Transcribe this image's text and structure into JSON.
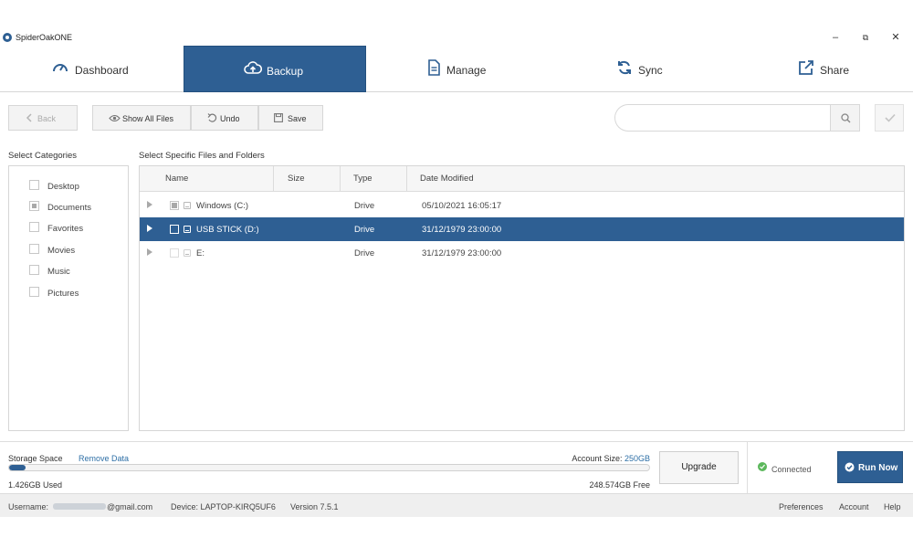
{
  "app": {
    "title": "SpiderOakONE",
    "logo_icon": "spideroak-logo-icon"
  },
  "window": {
    "minimize": "–",
    "restore": "⧉",
    "close": "✕"
  },
  "tabs": [
    {
      "label": "Dashboard",
      "icon": "gauge-icon",
      "active": false
    },
    {
      "label": "Backup",
      "icon": "cloud-upload-icon",
      "active": true
    },
    {
      "label": "Manage",
      "icon": "document-icon",
      "active": false
    },
    {
      "label": "Sync",
      "icon": "sync-icon",
      "active": false
    },
    {
      "label": "Share",
      "icon": "share-icon",
      "active": false
    }
  ],
  "toolbar": {
    "back_label": "Back",
    "show_all_label": "Show All Files",
    "undo_label": "Undo",
    "save_label": "Save",
    "search_placeholder": ""
  },
  "categories": {
    "header": "Select Categories",
    "items": [
      {
        "label": "Desktop",
        "state": "unchecked"
      },
      {
        "label": "Documents",
        "state": "partial"
      },
      {
        "label": "Favorites",
        "state": "unchecked"
      },
      {
        "label": "Movies",
        "state": "unchecked"
      },
      {
        "label": "Music",
        "state": "unchecked"
      },
      {
        "label": "Pictures",
        "state": "unchecked"
      }
    ]
  },
  "files": {
    "header": "Select Specific Files and Folders",
    "columns": [
      "Name",
      "Size",
      "Type",
      "Date Modified"
    ],
    "rows": [
      {
        "name": "Windows (C:)",
        "size": "",
        "type": "Drive",
        "modified": "05/10/2021 16:05:17",
        "state": "partial",
        "selected": false
      },
      {
        "name": "USB STICK (D:)",
        "size": "",
        "type": "Drive",
        "modified": "31/12/1979 23:00:00",
        "state": "unchecked",
        "selected": true
      },
      {
        "name": "E:",
        "size": "",
        "type": "Drive",
        "modified": "31/12/1979 23:00:00",
        "state": "unchecked",
        "selected": false
      }
    ]
  },
  "storage": {
    "label": "Storage Space",
    "remove_link": "Remove Data",
    "account_size_label": "Account Size:",
    "account_size_value": "250GB",
    "used": "1.426GB Used",
    "free": "248.574GB Free",
    "used_fraction": 0.0057
  },
  "actions": {
    "upgrade_label": "Upgrade",
    "connected_label": "Connected",
    "run_now_label": "Run Now"
  },
  "status_bar": {
    "username_label": "Username:",
    "username_value": "@gmail.com",
    "device": "Device: LAPTOP-KIRQ5UF6",
    "version": "Version 7.5.1",
    "preferences": "Preferences",
    "account": "Account",
    "help": "Help"
  },
  "colors": {
    "accent": "#2e5f93",
    "link": "#2e6fa6",
    "connected": "#5cb85c"
  }
}
